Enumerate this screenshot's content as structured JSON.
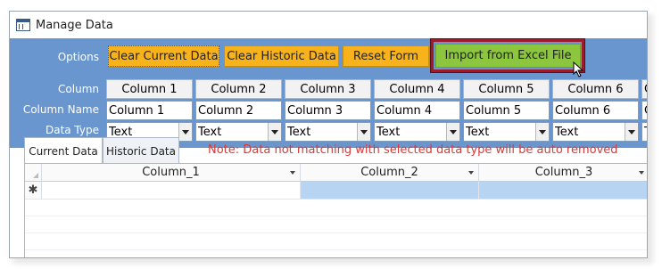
{
  "window": {
    "title": "Manage Data"
  },
  "options": {
    "label": "Options",
    "buttons": [
      {
        "label": "Clear Current Data"
      },
      {
        "label": "Clear Historic Data"
      },
      {
        "label": "Reset Form"
      },
      {
        "label": "Import from Excel File"
      }
    ]
  },
  "column_row_label": "Column",
  "column_name_label": "Column Name",
  "data_type_label": "Data Type",
  "columns": [
    {
      "header": "Column 1",
      "name": "Column 1",
      "type": "Text"
    },
    {
      "header": "Column 2",
      "name": "Column 2",
      "type": "Text"
    },
    {
      "header": "Column 3",
      "name": "Column 3",
      "type": "Text"
    },
    {
      "header": "Column 4",
      "name": "Column 4",
      "type": "Text"
    },
    {
      "header": "Column 5",
      "name": "Column 5",
      "type": "Text"
    },
    {
      "header": "Column 6",
      "name": "Column 6",
      "type": "Text"
    },
    {
      "header": "C",
      "name": "C",
      "type": "T"
    }
  ],
  "tabs": [
    {
      "label": "Current Data"
    },
    {
      "label": "Historic Data"
    }
  ],
  "note": "Note: Data not matching with selected data type will be auto removed",
  "grid": {
    "headers": [
      "Column_1",
      "Column_2",
      "Column_3"
    ],
    "new_row_marker": "✱"
  },
  "colors": {
    "form_background": "#6a96cf",
    "button_orange": "#f7b21c",
    "button_green": "#8cc63f",
    "highlight_border": "#9b1c2a",
    "note_red": "#d83a3a",
    "selected_cell": "#b8d4f3"
  }
}
